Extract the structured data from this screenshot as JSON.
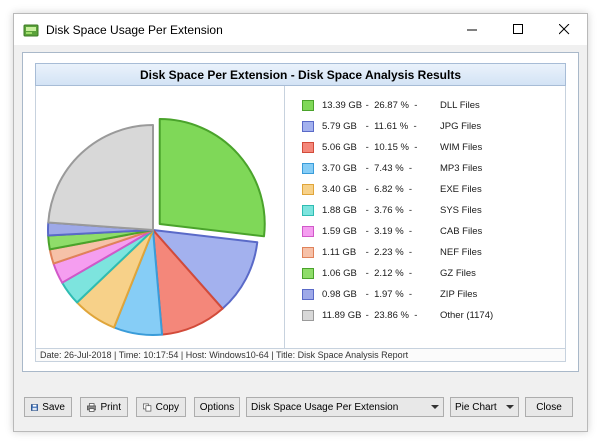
{
  "window": {
    "title": "Disk Space Usage Per Extension",
    "controls": [
      "minimize",
      "maximize",
      "close"
    ]
  },
  "report": {
    "header": "Disk Space Per Extension - Disk Space Analysis Results",
    "footer": "Date: 26-Jul-2018 | Time: 10:17:54 | Host: Windows10-64 | Title: Disk Space Analysis Report"
  },
  "chart_data": {
    "type": "pie",
    "title": "",
    "slices": [
      {
        "label": "DLL Files",
        "size": "13.39 GB",
        "value": 26.87,
        "pct_text": "26.87 %",
        "fill": "#7fd858",
        "stroke": "#4aa32b"
      },
      {
        "label": "JPG Files",
        "size": "5.79 GB",
        "value": 11.61,
        "pct_text": "11.61 %",
        "fill": "#a3b1ee",
        "stroke": "#5a6ac8"
      },
      {
        "label": "WIM Files",
        "size": "5.06 GB",
        "value": 10.15,
        "pct_text": "10.15 %",
        "fill": "#f4877a",
        "stroke": "#d24b3a"
      },
      {
        "label": "MP3 Files",
        "size": "3.70 GB",
        "value": 7.43,
        "pct_text": "7.43 %",
        "fill": "#86cdf6",
        "stroke": "#3a9cd9"
      },
      {
        "label": "EXE Files",
        "size": "3.40 GB",
        "value": 6.82,
        "pct_text": "6.82 %",
        "fill": "#f7d189",
        "stroke": "#e0a53a"
      },
      {
        "label": "SYS Files",
        "size": "1.88 GB",
        "value": 3.76,
        "pct_text": "3.76 %",
        "fill": "#7de4de",
        "stroke": "#2fbcb2"
      },
      {
        "label": "CAB Files",
        "size": "1.59 GB",
        "value": 3.19,
        "pct_text": "3.19 %",
        "fill": "#f59ef0",
        "stroke": "#d158c9"
      },
      {
        "label": "NEF Files",
        "size": "1.11 GB",
        "value": 2.23,
        "pct_text": "2.23 %",
        "fill": "#f6c1a8",
        "stroke": "#e0825a"
      },
      {
        "label": "GZ Files",
        "size": "1.06 GB",
        "value": 2.12,
        "pct_text": "2.12 %",
        "fill": "#8fdd6a",
        "stroke": "#4aa32b"
      },
      {
        "label": "ZIP Files",
        "size": "0.98 GB",
        "value": 1.97,
        "pct_text": "1.97 %",
        "fill": "#9ea9e8",
        "stroke": "#5a6ac8"
      },
      {
        "label": "Other (1174)",
        "size": "11.89 GB",
        "value": 23.86,
        "pct_text": "23.86 %",
        "fill": "#d8d8d8",
        "stroke": "#9a9a9a"
      }
    ]
  },
  "toolbar": {
    "save_label": "Save",
    "print_label": "Print",
    "copy_label": "Copy",
    "options_label": "Options",
    "report_select": "Disk Space Usage Per Extension",
    "chart_select": "Pie Chart",
    "close_label": "Close"
  },
  "icons": {
    "app": "pie-chart-icon",
    "save": "floppy-disk-icon",
    "print": "printer-icon",
    "copy": "copy-icon",
    "dropdown": "chevron-down-icon"
  },
  "colors": {
    "header_gradient_top": "#eaf2fb",
    "header_gradient_bottom": "#d3e3f5",
    "window_bg": "#f0f0f0"
  }
}
